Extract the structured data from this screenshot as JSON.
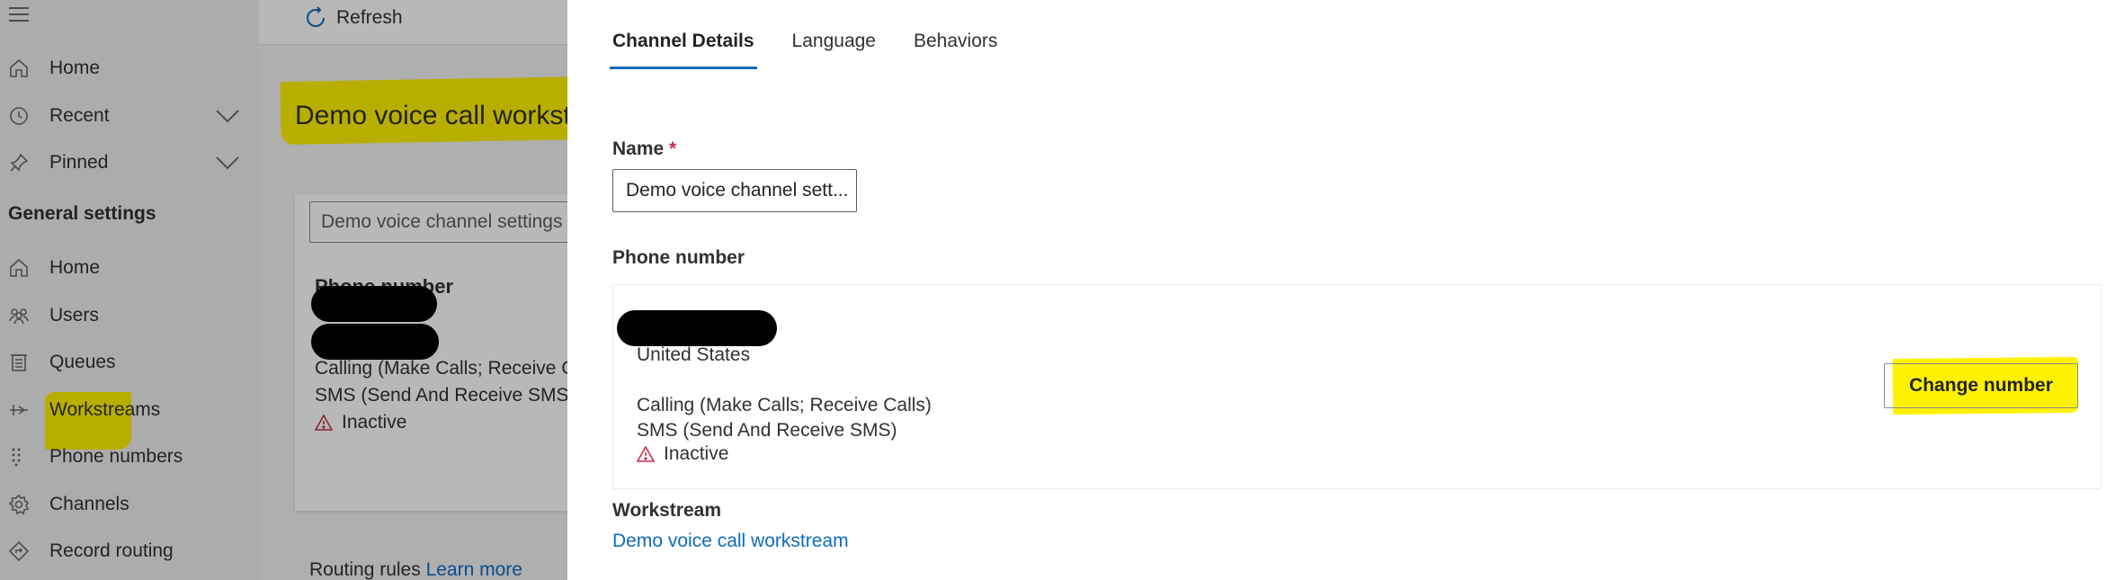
{
  "sidebar": {
    "menu_icon": "hamburger-icon",
    "top_items": [
      {
        "label": "Home",
        "icon": "home-icon"
      },
      {
        "label": "Recent",
        "icon": "clock-icon"
      },
      {
        "label": "Pinned",
        "icon": "pin-icon"
      }
    ],
    "section_title": "General settings",
    "section_items": [
      {
        "label": "Home",
        "icon": "home-icon"
      },
      {
        "label": "Users",
        "icon": "users-icon"
      },
      {
        "label": "Queues",
        "icon": "queues-icon"
      },
      {
        "label": "Workstreams",
        "icon": "workstreams-icon"
      },
      {
        "label": "Phone numbers",
        "icon": "dialpad-icon"
      },
      {
        "label": "Channels",
        "icon": "gear-icon"
      },
      {
        "label": "Record routing",
        "icon": "routing-icon"
      }
    ]
  },
  "commandbar": {
    "refresh_label": "Refresh",
    "refresh_icon": "refresh-icon"
  },
  "main": {
    "page_title": "Demo voice call workstream",
    "card": {
      "input_value": "Demo voice channel settings",
      "phone_label": "Phone number",
      "capability_calling": "Calling (Make Calls; Receive Calls)",
      "capability_sms": "SMS (Send And Receive SMS)",
      "status": "Inactive"
    },
    "routing_rules_label": "Routing rules",
    "learn_more": "Learn more"
  },
  "panel": {
    "tabs": [
      "Channel Details",
      "Language",
      "Behaviors"
    ],
    "active_tab": "Channel Details",
    "name_label": "Name",
    "required_marker": "*",
    "name_value": "Demo voice channel sett...",
    "phone_label": "Phone number",
    "phone": {
      "country": "United States",
      "capability_calling": "Calling (Make Calls; Receive Calls)",
      "capability_sms": "SMS (Send And Receive SMS)",
      "status": "Inactive",
      "status_icon": "warning-icon"
    },
    "change_number_label": "Change number",
    "workstream_label": "Workstream",
    "workstream_link": "Demo voice call workstream"
  },
  "colors": {
    "highlight": "#fff200",
    "accent": "#0f6cbd",
    "warning": "#c4314b",
    "sidebar_bg": "#efefef"
  }
}
